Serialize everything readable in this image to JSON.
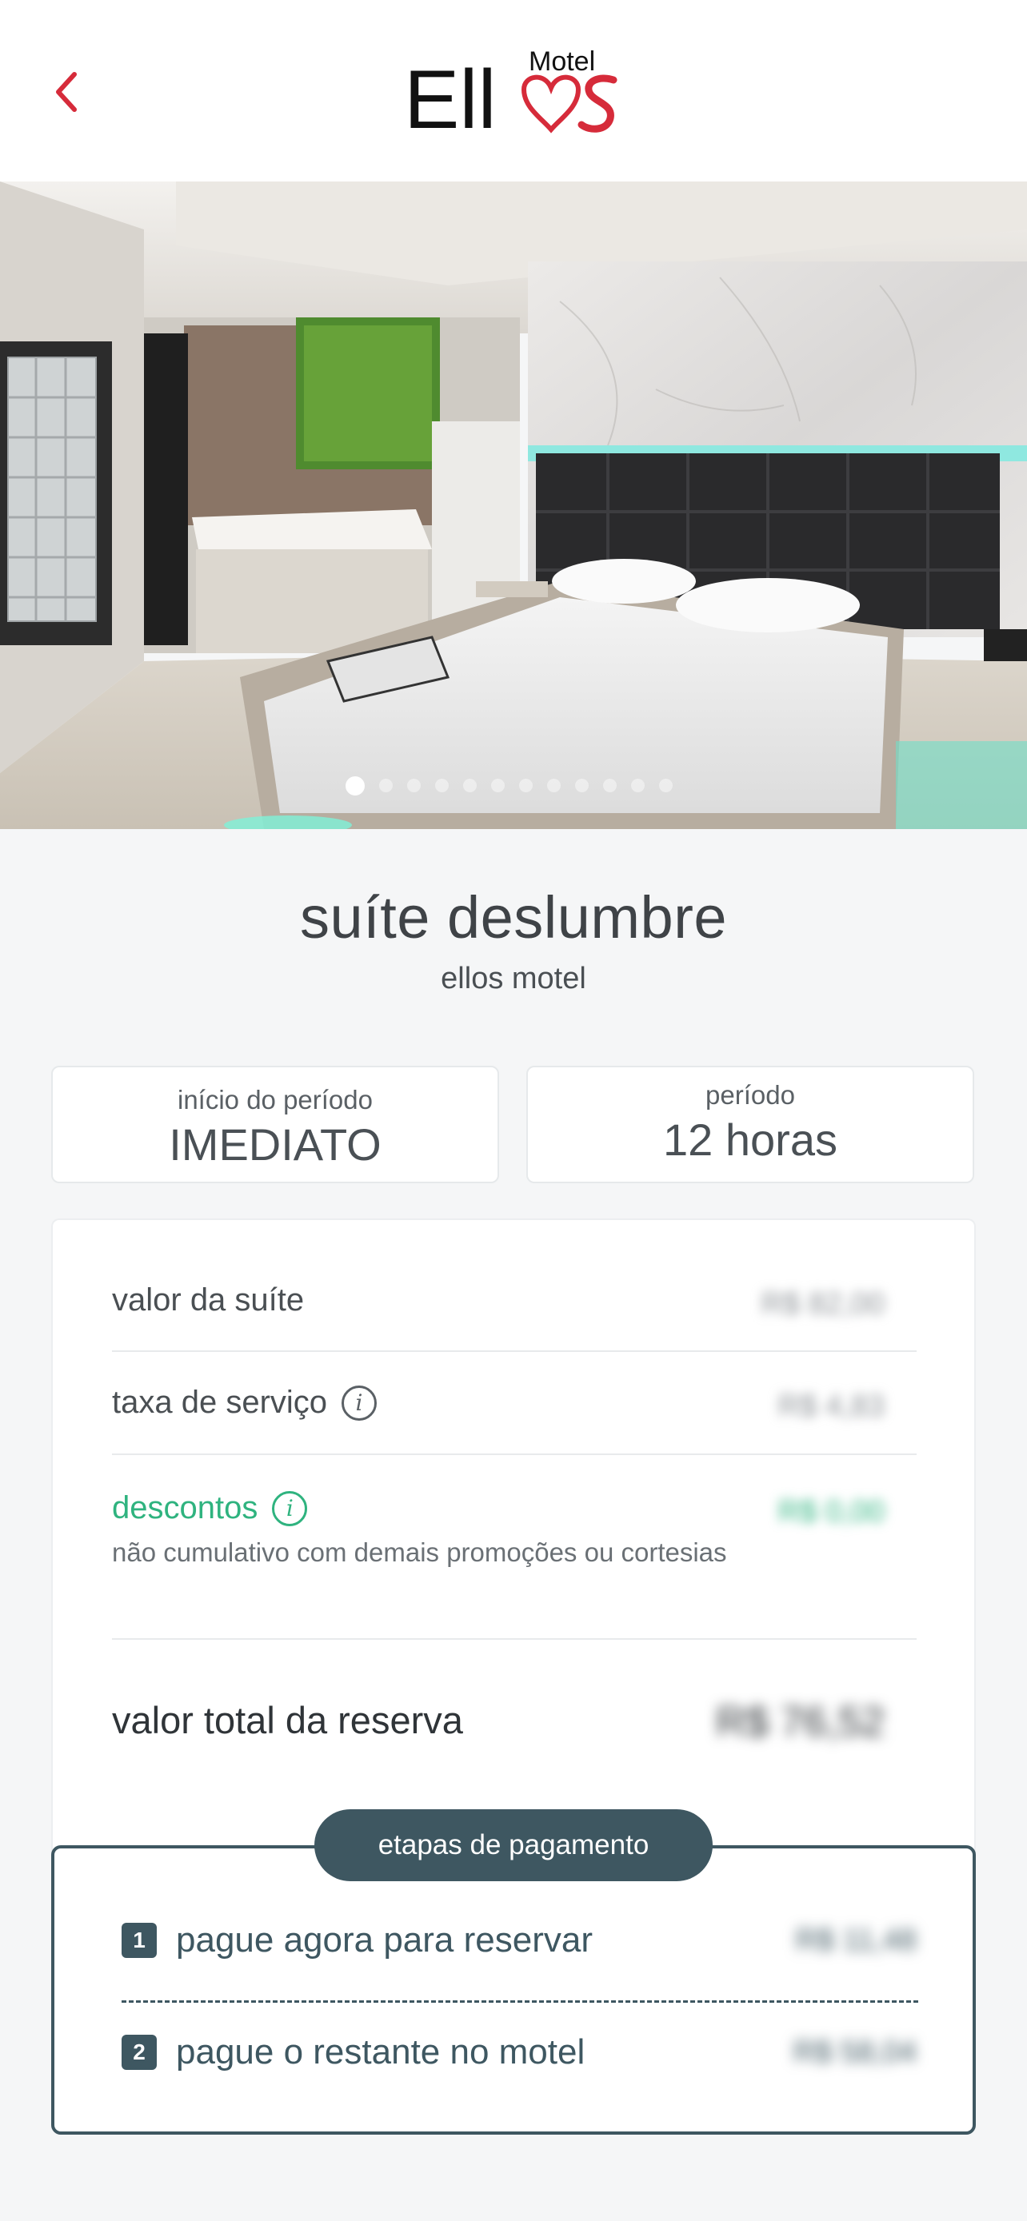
{
  "header": {
    "logo_text": "Ell",
    "logo_subtext": "Motel",
    "accent_color": "#d62b3a"
  },
  "gallery": {
    "total_images": 12,
    "active_index": 0
  },
  "suite": {
    "name": "suíte deslumbre",
    "motel": "ellos motel"
  },
  "period": {
    "start_label": "início do período",
    "start_value": "IMEDIATO",
    "duration_label": "período",
    "duration_value": "12 horas"
  },
  "summary": {
    "suite_value_label": "valor da suíte",
    "suite_value": "R$ 82,00",
    "service_fee_label": "taxa de serviço",
    "service_fee_value": "R$ 4,83",
    "discounts_label": "descontos",
    "discounts_value": "R$ 0,00",
    "discounts_note": "não cumulativo com demais promoções ou cortesias",
    "total_label": "valor total da reserva",
    "total_value": "R$ 76,52"
  },
  "payment_steps": {
    "title": "etapas de pagamento",
    "steps": [
      {
        "number": "1",
        "label": "pague agora para reservar",
        "value": "R$ 11,48"
      },
      {
        "number": "2",
        "label": "pague o restante no motel",
        "value": "R$ 58,04"
      }
    ],
    "color": "#3e5761"
  }
}
